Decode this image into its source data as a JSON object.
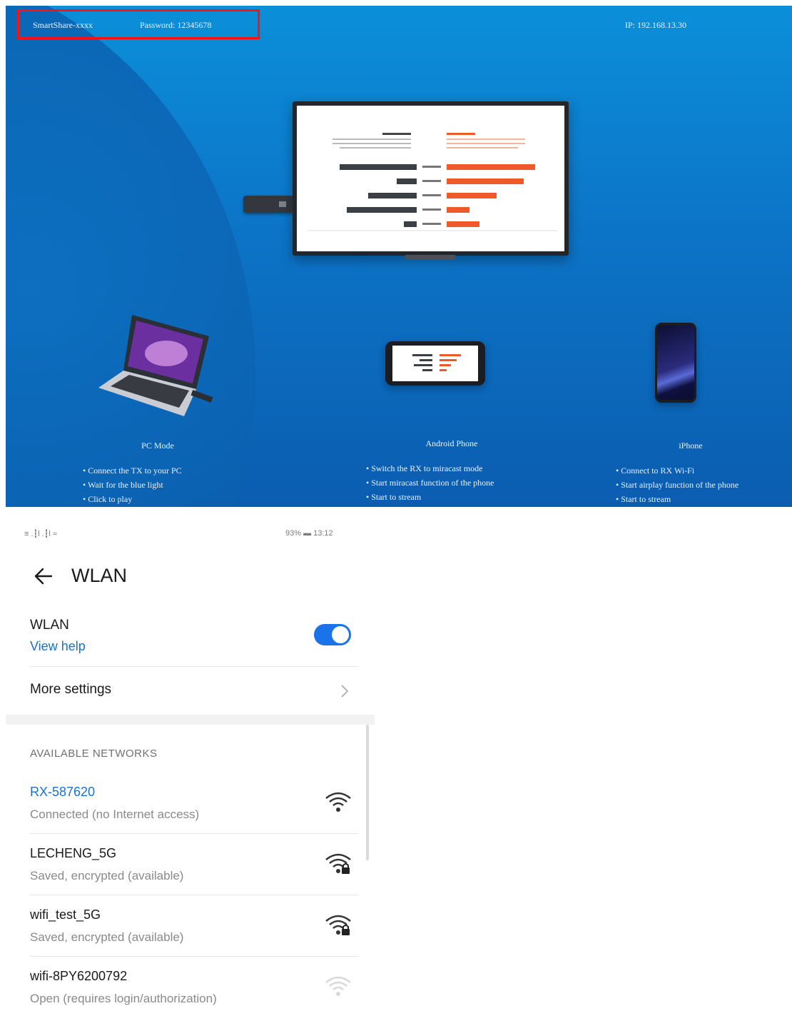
{
  "banner": {
    "ssid_text": "SmartShare-xxxx",
    "password_text": "Password: 12345678",
    "ip_text": "IP: 192.168.13.30",
    "modes": [
      {
        "title": "PC Mode",
        "bullets": [
          "• Connect the TX to your PC",
          "• Wait for the blue light",
          "• Click to play"
        ]
      },
      {
        "title": "Android Phone",
        "bullets": [
          "• Switch the RX to miracast mode",
          "• Start miracast function of the phone",
          "• Start to stream"
        ]
      },
      {
        "title": "iPhone",
        "bullets": [
          "• Connect to RX Wi-Fi",
          "• Start airplay function of the phone",
          "• Start to stream"
        ]
      }
    ],
    "colors": {
      "background": "#0b7fd0",
      "highlight_box": "#ff1111",
      "bar_dark": "#3b3f46",
      "bar_orange": "#ee5a2a"
    },
    "icons": [
      "dongle-icon",
      "tv-icon",
      "laptop-icon",
      "android-phone-icon",
      "iphone-icon"
    ]
  },
  "phone": {
    "status_left": "≡ .┇l .┇l ≈",
    "status_right": "93% ▬ 13:12",
    "title": "WLAN",
    "wlan_label": "WLAN",
    "view_help": "View help",
    "wlan_enabled": true,
    "more_settings": "More settings",
    "section_header": "AVAILABLE NETWORKS",
    "networks": [
      {
        "name": "RX-587620",
        "status": "Connected (no Internet access)",
        "connected": true,
        "icon": "wifi-signal-icon"
      },
      {
        "name": "LECHENG_5G",
        "status": "Saved, encrypted (available)",
        "connected": false,
        "icon": "wifi-locked-icon"
      },
      {
        "name": "wifi_test_5G",
        "status": "Saved, encrypted (available)",
        "connected": false,
        "icon": "wifi-locked-icon"
      },
      {
        "name": "wifi-8PY6200792",
        "status": "Open (requires login/authorization)",
        "connected": false,
        "icon": "wifi-weak-icon"
      }
    ],
    "colors": {
      "accent": "#1672d6",
      "toggle_on": "#1a73e8"
    }
  }
}
